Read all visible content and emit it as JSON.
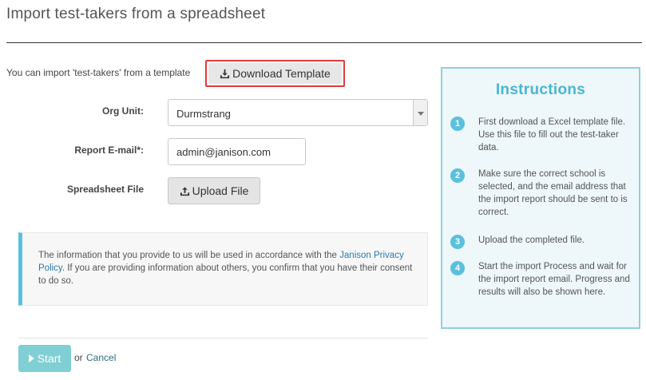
{
  "page_title": "Import test-takers from a spreadsheet",
  "intro_text": "You can import 'test-takers' from a template",
  "download_button": {
    "label": "Download Template",
    "icon": "download-icon"
  },
  "form": {
    "org_unit": {
      "label": "Org Unit:",
      "value": "Durmstrang"
    },
    "report_email": {
      "label": "Report E-mail*:",
      "value": "admin@janison.com"
    },
    "spreadsheet_file": {
      "label": "Spreadsheet File",
      "button_label": "Upload File",
      "icon": "upload-icon"
    }
  },
  "privacy": {
    "text_before": "The information that you provide to us will be used in accordance with the ",
    "link_text": "Janison Privacy Policy",
    "text_after": ". If you are providing information about others, you confirm that you have their consent to do so."
  },
  "actions": {
    "start_label": "Start",
    "or_text": "or",
    "cancel_label": "Cancel"
  },
  "instructions": {
    "title": "Instructions",
    "steps": [
      {
        "num": "1",
        "text": "First download a Excel template file. Use this file to fill out the test-taker data."
      },
      {
        "num": "2",
        "text": "Make sure the correct school is selected, and the email address that the import report should be sent to is correct."
      },
      {
        "num": "3",
        "text": "Upload the completed file."
      },
      {
        "num": "4",
        "text": "Start the import Process and wait for the import report email. Progress and results will also be shown here."
      }
    ]
  },
  "colors": {
    "accent": "#5bc0de",
    "highlight_border": "#e03b3b",
    "start_button": "#7fcfd4",
    "link": "#2a7ab0"
  }
}
